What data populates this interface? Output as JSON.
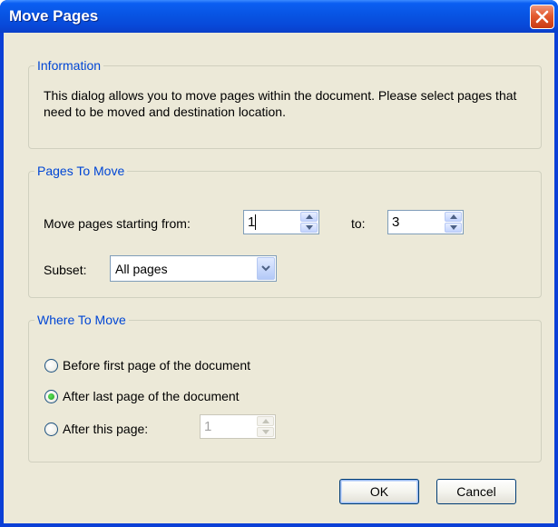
{
  "window": {
    "title": "Move Pages",
    "close_icon": "close-icon"
  },
  "information": {
    "legend": "Information",
    "text": "This dialog allows you to move pages within the document. Please select pages that need to be moved and destination location."
  },
  "pages_to_move": {
    "legend": "Pages To Move",
    "start_label": "Move pages starting from:",
    "start_value": "1",
    "to_label": "to:",
    "to_value": "3",
    "subset_label": "Subset:",
    "subset_value": "All pages"
  },
  "where_to_move": {
    "legend": "Where To Move",
    "options": [
      {
        "label": "Before first page of the document",
        "selected": false
      },
      {
        "label": "After last page of the document",
        "selected": true
      },
      {
        "label": "After this page:",
        "selected": false
      }
    ],
    "after_page_value": "1"
  },
  "buttons": {
    "ok": "OK",
    "cancel": "Cancel"
  },
  "colors": {
    "titlebar": "#0854e3",
    "legend_text": "#0046d5",
    "dialog_bg": "#ece9d8",
    "radio_selected": "#21a121"
  }
}
